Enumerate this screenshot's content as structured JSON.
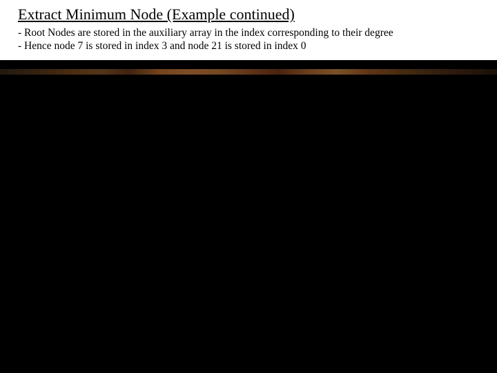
{
  "slide": {
    "title": "Extract Minimum Node  (Example continued)",
    "line1": "- Root Nodes are stored in the auxiliary array in the index corresponding to their degree",
    "line2": "- Hence node 7  is stored in index 3 and node 21 is stored in index 0"
  }
}
